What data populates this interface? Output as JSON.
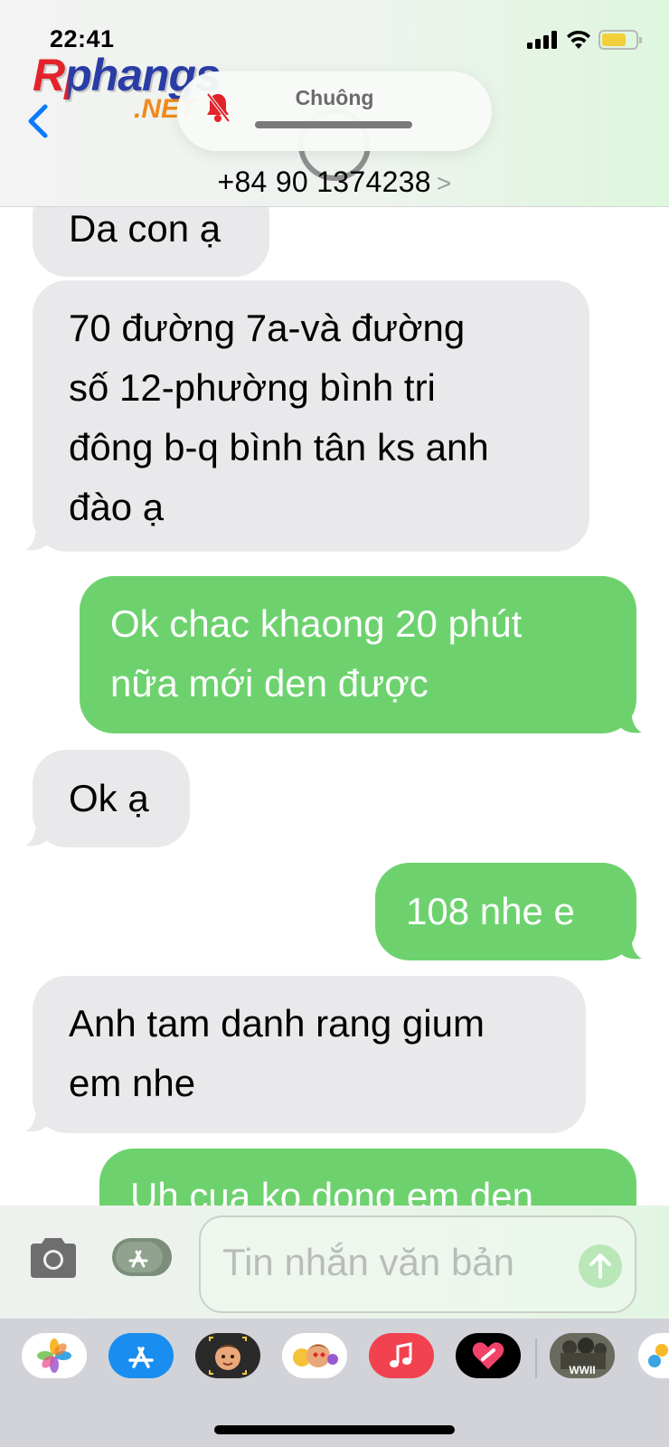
{
  "status": {
    "time": "22:41",
    "battery_color": "#f2cf3b"
  },
  "logo": {
    "main": "Rphangs",
    "sub": ".NET"
  },
  "popup": {
    "label": "Chuông"
  },
  "contact": {
    "name": "+84 90 1374238",
    "chevron": ">"
  },
  "messages": [
    {
      "dir": "in",
      "lines": [
        "Da con ạ"
      ]
    },
    {
      "dir": "in",
      "lines": [
        "70 đường 7a-và đường",
        "số 12-phường bình tri",
        "đông b-q bình tân ks anh",
        "đào ạ"
      ]
    },
    {
      "dir": "out",
      "lines": [
        "Ok chac khaong 20 phút",
        "nữa mới den được"
      ]
    },
    {
      "dir": "in",
      "lines": [
        "Ok ạ"
      ]
    },
    {
      "dir": "out",
      "lines": [
        "108 nhe e"
      ]
    },
    {
      "dir": "in",
      "lines": [
        "Anh tam danh rang gium",
        "em nhe"
      ]
    },
    {
      "dir": "out",
      "lines": [
        "Uh cua ko dong em den"
      ]
    }
  ],
  "compose": {
    "placeholder": "Tin nhắn văn bản"
  },
  "drawer": {
    "apps": [
      "photos-app",
      "app-store-app",
      "memoji-app",
      "animoji-stickers-app",
      "music-app",
      "digital-touch-app",
      "game-app",
      "more-app"
    ],
    "game_label": "WWII"
  },
  "colors": {
    "incoming": "#e9e9eb",
    "outgoing": "#6dd26e",
    "accent": "#0a7aff"
  }
}
